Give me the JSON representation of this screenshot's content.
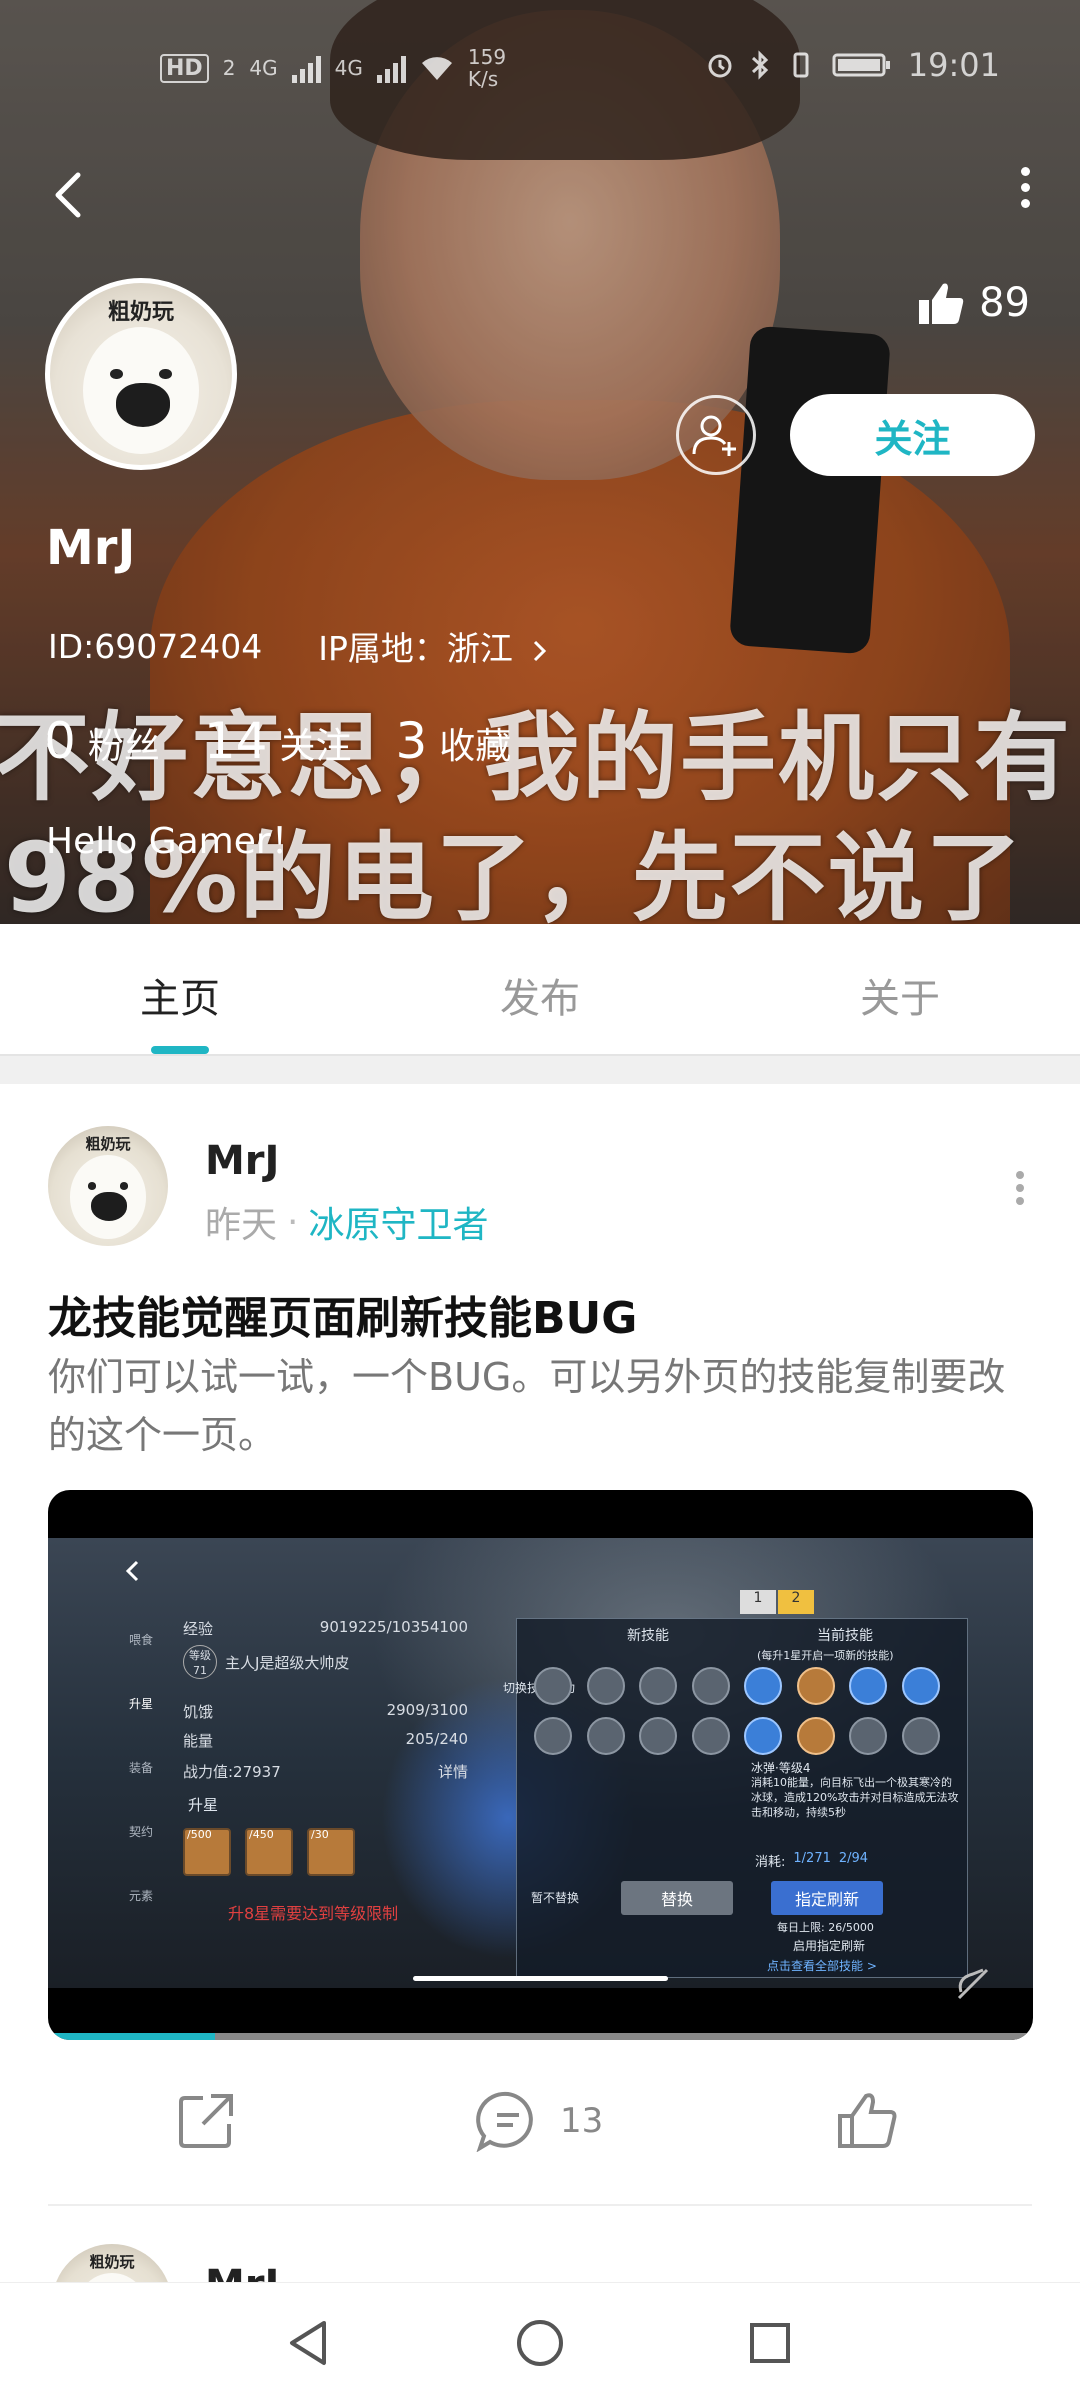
{
  "status_bar": {
    "network_badge": "HD",
    "network_sub": "2",
    "sig1": "4G",
    "sig2": "4G",
    "speed_value": "159",
    "speed_unit": "K/s",
    "time": "19:01"
  },
  "profile": {
    "avatar_tag": "粗奶玩",
    "likes_count": "89",
    "follow_label": "关注",
    "username": "MrJ",
    "id_text": "ID:69072404",
    "ip_text": "IP属地：浙江",
    "stats": [
      {
        "num": "0",
        "label": "粉丝"
      },
      {
        "num": "14",
        "label": "关注"
      },
      {
        "num": "3",
        "label": "收藏"
      }
    ],
    "bio": "Hello Gamer！"
  },
  "header_image": {
    "meme_line1": "不好意思，我的手机只有",
    "meme_line2": "98%的电了，先不说了"
  },
  "tabs": [
    {
      "label": "主页",
      "active": true
    },
    {
      "label": "发布",
      "active": false
    },
    {
      "label": "关于",
      "active": false
    }
  ],
  "post": {
    "avatar_tag": "粗奶玩",
    "author": "MrJ",
    "time": "昨天",
    "separator": "·",
    "game": "冰原守卫者",
    "title": "龙技能觉醒页面刷新技能BUG",
    "body": "你们可以试一试，一个BUG。可以另外页的技能复制要改的这个一页。",
    "video_progress": 0.17,
    "comment_count": "13"
  },
  "game_screenshot": {
    "exp_label": "经验",
    "exp_value": "9019225/10354100",
    "level_label": "等级",
    "level_value": "71",
    "player_name": "主人J是超级大帅皮",
    "hunger_label": "饥饿",
    "hunger_value": "2909/3100",
    "energy_label": "能量",
    "energy_value": "205/240",
    "power_label": "战力值:27937",
    "detail_label": "详情",
    "sidebar": [
      "喂食",
      "升星",
      "装备",
      "契约",
      "元素"
    ],
    "upgrade_label": "升星",
    "items": [
      "/500",
      "/450",
      "/30"
    ],
    "red_hint": "升8星需要达到等级限制",
    "tab1": "1",
    "tab2": "2",
    "new_skill": "新技能",
    "current_skill": "当前技能",
    "panel_note": "(每升1星开启一项新的技能)",
    "switch_success": "切换技能成功",
    "skill_name": "冰弹·等级4",
    "skill_desc": "消耗10能量，向目标飞出一个极其寒冷的冰球，造成120%攻击并对目标造成无法攻击和移动，持续5秒",
    "consume_label": "消耗:",
    "consume_a": "1/271",
    "consume_b": "2/94",
    "no_replace": "暂不替换",
    "replace": "替换",
    "refresh": "指定刷新",
    "daily_limit": "每日上限: 26/5000",
    "enable_refresh": "启用指定刷新",
    "view_all": "点击查看全部技能 >"
  },
  "next_post": {
    "avatar_tag": "粗奶玩",
    "author": "MrJ"
  },
  "colors": {
    "accent": "#1fb6c4",
    "muted": "#999999"
  }
}
